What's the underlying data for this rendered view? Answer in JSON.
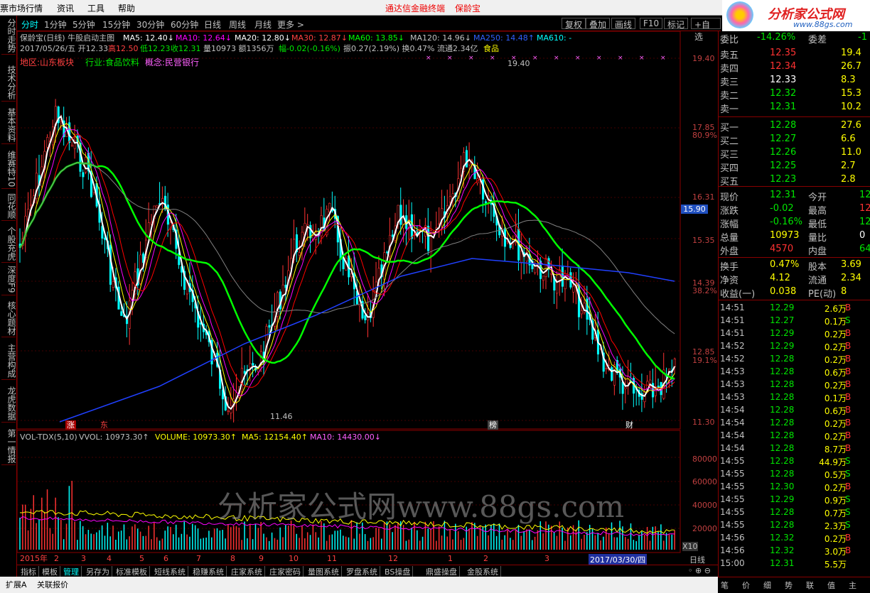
{
  "menubar": {
    "items": [
      "票市场行情",
      "资讯",
      "工具",
      "帮助"
    ],
    "center_title": "通达信金融终端",
    "stock_title": "保龄宝"
  },
  "logo": {
    "text": "分析家公式网",
    "url": "www.88gs.com"
  },
  "leftnav": {
    "items": [
      "分时走势",
      "技术分析",
      "基本资料",
      "维赛特10",
      "同花顺",
      "个股充虎",
      "深度F9",
      "核心题材",
      "主营构成",
      "龙虎数据",
      "第一情报"
    ]
  },
  "toolbar": {
    "periods": [
      "分时",
      "1分钟",
      "5分钟",
      "15分钟",
      "30分钟",
      "60分钟",
      "日线",
      "周线",
      "月线",
      "更多 >"
    ],
    "right_buttons": [
      "复权",
      "叠加",
      "画线",
      "F10",
      "标记",
      "+自选"
    ]
  },
  "chart_header": {
    "title": "保龄宝(日线) 牛股启动主图",
    "ma5": "MA5: 12.40↓",
    "ma10": "MA10: 12.64↓",
    "ma20": "MA20: 12.80↓",
    "ma30": "MA30: 12.87↓",
    "ma60": "MA60: 13.85↓",
    "ma120": "MA120: 14.96↓",
    "ma250": "MA250: 14.48↑",
    "ma610": "MA610: -",
    "info_date": "2017/05/26/五 开12.33",
    "info_high": "高12.50",
    "info_low": "低12.23",
    "info_close": "收12.31",
    "info_vol": "量10973 额1356万",
    "info_change": "幅-0.02(-0.16%)",
    "info_rest": "振0.27(2.19%) 换0.47% 流通2.34亿",
    "info_sector": "食品",
    "region": "地区:山东板块",
    "industry": "行业:食品饮料",
    "concept": "概念:民营银行"
  },
  "price_axis": {
    "labels": [
      "19.40",
      "17.85",
      "80.9%",
      "16.31",
      "15.35",
      "14.39",
      "38.2%",
      "12.85",
      "19.1%",
      "11.30"
    ],
    "current_tag": "15.90"
  },
  "chart_markers": {
    "high_label": "19.40",
    "low_label": "11.46",
    "zhang": "涨",
    "fa": "东",
    "bang": "榜",
    "cai": "财"
  },
  "volume_header": {
    "name": "VOL-TDX(5,10)",
    "vvol": "VVOL: 10973.30↑",
    "volume": "VOLUME: 10973.30↑",
    "ma5": "MA5: 12154.40↑",
    "ma10": "MA10: 14430.00↓"
  },
  "volume_axis": {
    "labels": [
      "80000",
      "60000",
      "40000",
      "20000"
    ],
    "unit": "X10"
  },
  "watermark": "分析家公式网www.88gs.com",
  "date_axis": {
    "labels": [
      "2015年",
      "2",
      "3",
      "4",
      "5",
      "6",
      "7",
      "8",
      "9",
      "10",
      "11",
      "12",
      "1",
      "2",
      "3"
    ],
    "cursor_date": "2017/03/30/四",
    "period": "日线"
  },
  "bottom_tabs": [
    "指标",
    "模板",
    "管理",
    "另存为",
    "标准模板",
    "短线系统",
    "稳赚系统",
    "庄家系统",
    "庄家密码",
    "量图系统",
    "罗盘系统",
    "BS操盘",
    "鼎盛操盘",
    "金股系统"
  ],
  "bottom_row2": [
    "扩展A",
    "关联报价"
  ],
  "quote": {
    "weibi_label": "委比",
    "weibi_value": "-14.26%",
    "weicha_label": "委差",
    "weicha_value": "-1",
    "asks": [
      {
        "label": "卖五",
        "price": "12.35",
        "vol": "19.4"
      },
      {
        "label": "卖四",
        "price": "12.34",
        "vol": "26.7"
      },
      {
        "label": "卖三",
        "price": "12.33",
        "vol": "8.3"
      },
      {
        "label": "卖二",
        "price": "12.32",
        "vol": "15.3"
      },
      {
        "label": "卖一",
        "price": "12.31",
        "vol": "10.2"
      }
    ],
    "bids": [
      {
        "label": "买一",
        "price": "12.28",
        "vol": "27.6"
      },
      {
        "label": "买二",
        "price": "12.27",
        "vol": "6.6"
      },
      {
        "label": "买三",
        "price": "12.26",
        "vol": "11.0"
      },
      {
        "label": "买四",
        "price": "12.25",
        "vol": "2.7"
      },
      {
        "label": "买五",
        "price": "12.23",
        "vol": "2.8"
      }
    ],
    "stats": [
      {
        "l1": "现价",
        "v1": "12.31",
        "l2": "今开",
        "v2": "12"
      },
      {
        "l1": "涨跌",
        "v1": "-0.02",
        "l2": "最高",
        "v2": "12"
      },
      {
        "l1": "涨幅",
        "v1": "-0.16%",
        "l2": "最低",
        "v2": "12"
      },
      {
        "l1": "总量",
        "v1": "10973",
        "l2": "量比",
        "v2": "0"
      },
      {
        "l1": "外盘",
        "v1": "4570",
        "l2": "内盘",
        "v2": "64"
      }
    ],
    "stats2": [
      {
        "l1": "换手",
        "v1": "0.47%",
        "l2": "股本",
        "v2": "3.69"
      },
      {
        "l1": "净资",
        "v1": "4.12",
        "l2": "流通",
        "v2": "2.34"
      },
      {
        "l1": "收益(一)",
        "v1": "0.038",
        "l2": "PE(动)",
        "v2": "8"
      }
    ],
    "ticks": [
      {
        "t": "14:51",
        "p": "12.29",
        "v": "2.6万",
        "s": "B"
      },
      {
        "t": "14:51",
        "p": "12.27",
        "v": "0.1万",
        "s": "S"
      },
      {
        "t": "14:51",
        "p": "12.29",
        "v": "0.2万",
        "s": "B"
      },
      {
        "t": "14:52",
        "p": "12.29",
        "v": "0.2万",
        "s": "B"
      },
      {
        "t": "14:52",
        "p": "12.28",
        "v": "0.2万",
        "s": "B"
      },
      {
        "t": "14:53",
        "p": "12.28",
        "v": "0.6万",
        "s": "B"
      },
      {
        "t": "14:53",
        "p": "12.28",
        "v": "0.2万",
        "s": "B"
      },
      {
        "t": "14:53",
        "p": "12.28",
        "v": "0.1万",
        "s": "B"
      },
      {
        "t": "14:54",
        "p": "12.28",
        "v": "0.6万",
        "s": "B"
      },
      {
        "t": "14:54",
        "p": "12.28",
        "v": "0.2万",
        "s": "B"
      },
      {
        "t": "14:54",
        "p": "12.28",
        "v": "0.2万",
        "s": "B"
      },
      {
        "t": "14:54",
        "p": "12.28",
        "v": "8.7万",
        "s": "B"
      },
      {
        "t": "14:55",
        "p": "12.28",
        "v": "44.9万",
        "s": "S"
      },
      {
        "t": "14:55",
        "p": "12.28",
        "v": "0.5万",
        "s": "S"
      },
      {
        "t": "14:55",
        "p": "12.30",
        "v": "0.2万",
        "s": "B"
      },
      {
        "t": "14:55",
        "p": "12.29",
        "v": "0.9万",
        "s": "S"
      },
      {
        "t": "14:55",
        "p": "12.28",
        "v": "0.7万",
        "s": "S"
      },
      {
        "t": "14:55",
        "p": "12.28",
        "v": "2.3万",
        "s": "S"
      },
      {
        "t": "14:56",
        "p": "12.32",
        "v": "0.2万",
        "s": "B"
      },
      {
        "t": "14:56",
        "p": "12.32",
        "v": "3.0万",
        "s": "B"
      },
      {
        "t": "15:00",
        "p": "12.31",
        "v": "5.5万",
        "s": ""
      }
    ],
    "bottom_tabs": [
      "笔",
      "价",
      "细",
      "势",
      "联",
      "值",
      "主"
    ]
  },
  "colors": {
    "up": "#ff3232",
    "down": "#00e600",
    "flat": "#ffffff",
    "ma5": "#ffffff",
    "ma10": "#ffff00",
    "ma20": "#ff00ff",
    "ma30": "#ff0000",
    "ma60": "#00ff00",
    "ma120": "#808080",
    "ma250": "#0000ff",
    "ma610": "#00ffff"
  }
}
